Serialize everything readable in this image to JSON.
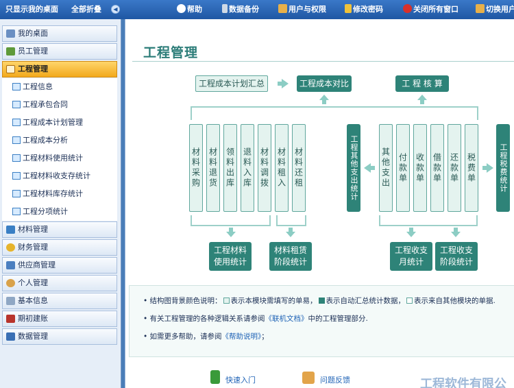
{
  "topbar": {
    "left": [
      "只显示我的桌面",
      "全部折叠"
    ],
    "right": [
      {
        "label": "帮助",
        "icon": "help-icon"
      },
      {
        "label": "数据备份",
        "icon": "backup-icon"
      },
      {
        "label": "用户与权限",
        "icon": "users-icon"
      },
      {
        "label": "修改密码",
        "icon": "key-icon"
      },
      {
        "label": "关闭所有窗口",
        "icon": "close-all-icon"
      },
      {
        "label": "切换用户",
        "icon": "switch-user-icon"
      }
    ]
  },
  "sidebar": {
    "items": [
      {
        "label": "我的桌面"
      },
      {
        "label": "员工管理"
      },
      {
        "label": "工程管理"
      },
      {
        "label": "材料管理"
      },
      {
        "label": "财务管理"
      },
      {
        "label": "供应商管理"
      },
      {
        "label": "个人管理"
      },
      {
        "label": "基本信息"
      },
      {
        "label": "期初建账"
      },
      {
        "label": "数据管理"
      }
    ],
    "subitems": [
      {
        "label": "工程信息"
      },
      {
        "label": "工程承包合同"
      },
      {
        "label": "工程成本计划管理"
      },
      {
        "label": "工程成本分析"
      },
      {
        "label": "工程材料使用统计"
      },
      {
        "label": "工程材料收支存统计"
      },
      {
        "label": "工程材料库存统计"
      },
      {
        "label": "工程分项统计"
      }
    ]
  },
  "main": {
    "title": "工程管理",
    "flow": {
      "plan_summary": "工程成本计划汇总",
      "cost_compare": "工程成本对比",
      "audit": "工 程 核 算",
      "left_boxes": [
        "材料采购",
        "材料退货",
        "领料出库",
        "退料入库",
        "材料调拨",
        "材料租入",
        "材料还租"
      ],
      "other_expense_stat": "工程其他支出统计",
      "right_boxes": [
        "其他支出",
        "付款单",
        "收款单",
        "借款单",
        "还款单",
        "税费单"
      ],
      "tax_stat": "工程税费统计",
      "material_use_stat": [
        "工程材料",
        "使用统计"
      ],
      "rent_stage_stat": [
        "材料租赁",
        "阶段统计"
      ],
      "monthly_stat": [
        "工程收支",
        "月统计"
      ],
      "stage_stat": [
        "工程收支",
        "阶段统计"
      ]
    },
    "notes": {
      "legend_prefix": "结构图背景颜色说明：",
      "legend_light": "表示本模块需填写的单易，",
      "legend_dark": "表示自动汇总统计数据，",
      "legend_white": "表示来自其他模块的单据.",
      "note2_prefix": "有关工程管理的各种逻辑关系请参阅",
      "note2_link": "《联机文档》",
      "note2_suffix": "中的工程管理部分.",
      "note3_prefix": "如需更多帮助，请参阅",
      "note3_link": "《帮助说明》",
      "note3_suffix": "；"
    },
    "bottom": {
      "quick_start": "快速入门",
      "feedback": "问题反馈",
      "brand": "工程软件有限公"
    }
  }
}
